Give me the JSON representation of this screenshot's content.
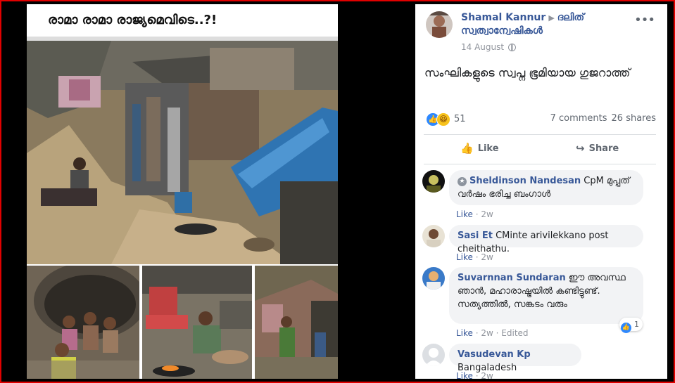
{
  "photo": {
    "title": "രാമാ രാമാ രാജ്യമെവിടെ..?!"
  },
  "post": {
    "author": "Shamal Kannur",
    "group": "ദലിത് സ്വത്വാന്വേഷികൾ",
    "date": "14 August",
    "text": "സംഘികളുടെ സ്വപ്ന ഭൂമിയായ ഗുജറാത്ത്",
    "reaction_count": "51",
    "comments": "7 comments",
    "shares": "26 shares",
    "like_label": "Like",
    "share_label": "Share",
    "more_icon": "more-options-icon",
    "colors": {
      "link": "#385898",
      "frame": "#e00000",
      "like": "#2d88ff"
    }
  },
  "comments": [
    {
      "name": "Sheldinson Nandesan",
      "text": "CpM മുപ്പത് വർഷം ഭരിച്ച ബംഗാൾ",
      "like": "Like",
      "time": "2w",
      "edited": "",
      "reactions": ""
    },
    {
      "name": "Sasi Et",
      "text": "CMinte arivilekkano post cheithathu.",
      "like": "Like",
      "time": "2w",
      "edited": "",
      "reactions": ""
    },
    {
      "name": "Suvarnnan Sundaran",
      "text": "ഈ അവസ്ഥ ഞാൻ, മഹാരാഷ്ട്രയിൽ കണ്ടിട്ടുണ്ട്. സത്യത്തിൽ, സങ്കടം വരും",
      "like": "Like",
      "time": "2w",
      "edited": "Edited",
      "reactions": "1"
    },
    {
      "name": "Vasudevan Kp",
      "text": "Bangaladesh",
      "like": "Like",
      "time": "2w",
      "edited": "",
      "reactions": ""
    }
  ]
}
